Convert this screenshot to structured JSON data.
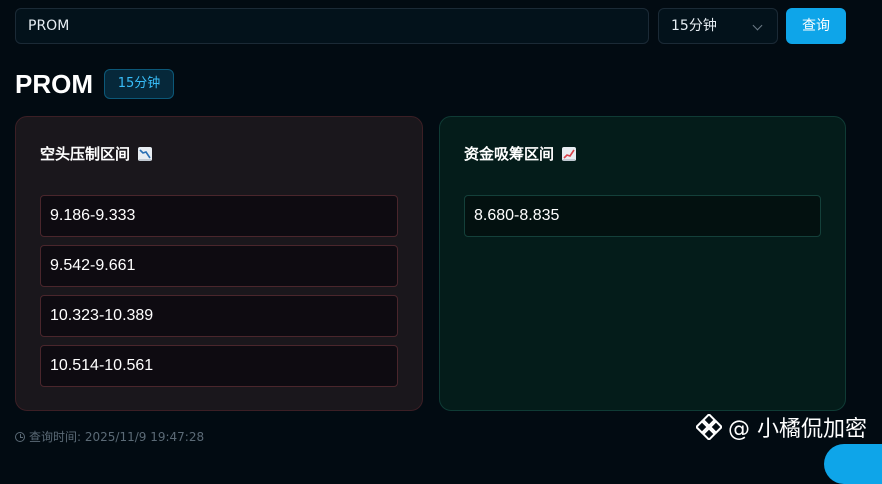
{
  "search": {
    "value": "PROM"
  },
  "interval": {
    "selected": "15分钟"
  },
  "query_button_label": "查询",
  "title": "PROM",
  "badge": "15分钟",
  "bear_panel": {
    "title": "空头压制区间",
    "icon": "chart-decreasing-icon",
    "zones": [
      "9.186-9.333",
      "9.542-9.661",
      "10.323-10.389",
      "10.514-10.561"
    ]
  },
  "bull_panel": {
    "title": "资金吸筹区间",
    "icon": "chart-increasing-icon",
    "zones": [
      "8.680-8.835"
    ]
  },
  "footer": {
    "label": "查询时间: 2025/11/9 19:47:28"
  },
  "watermark": {
    "text": "@ 小橘侃加密",
    "logo": "binance-logo-icon"
  },
  "colors": {
    "background": "#020b12",
    "accent": "#0ea5e9",
    "bear_border": "#4a262c",
    "bull_border": "#14403a"
  }
}
